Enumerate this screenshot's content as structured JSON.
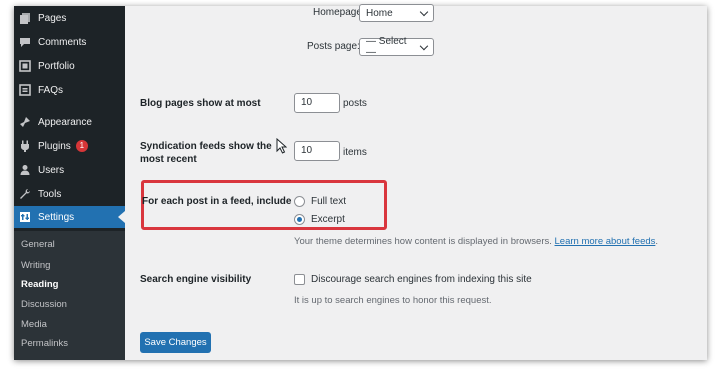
{
  "sidebar": {
    "items": [
      {
        "label": "Pages",
        "icon": "pages-icon"
      },
      {
        "label": "Comments",
        "icon": "comment-icon"
      },
      {
        "label": "Portfolio",
        "icon": "portfolio-icon"
      },
      {
        "label": "FAQs",
        "icon": "faq-icon"
      },
      {
        "label": "Appearance",
        "icon": "appearance-icon"
      },
      {
        "label": "Plugins",
        "icon": "plugins-icon",
        "badge": "1"
      },
      {
        "label": "Users",
        "icon": "users-icon"
      },
      {
        "label": "Tools",
        "icon": "tools-icon"
      },
      {
        "label": "Settings",
        "icon": "settings-icon",
        "active": true
      }
    ],
    "submenu": [
      {
        "label": "General"
      },
      {
        "label": "Writing"
      },
      {
        "label": "Reading",
        "current": true
      },
      {
        "label": "Discussion"
      },
      {
        "label": "Media"
      },
      {
        "label": "Permalinks"
      }
    ]
  },
  "settings": {
    "homepage_label": "Homepage:",
    "homepage_value": "Home",
    "posts_page_label": "Posts page:",
    "posts_page_value": "— Select —",
    "blog_pages_label": "Blog pages show at most",
    "blog_pages_value": "10",
    "blog_pages_unit": "posts",
    "syndication_label_line1": "Syndication feeds show the",
    "syndication_label_line2": "most recent",
    "syndication_value": "10",
    "syndication_unit": "items",
    "feed_include_label": "For each post in a feed, include",
    "feed_options": [
      {
        "label": "Full text",
        "checked": false
      },
      {
        "label": "Excerpt",
        "checked": true
      }
    ],
    "feed_desc": "Your theme determines how content is displayed in browsers.",
    "feed_desc_link": "Learn more about feeds",
    "feed_desc_end": ".",
    "search_visibility_label": "Search engine visibility",
    "search_visibility_checkbox": "Discourage search engines from indexing this site",
    "search_visibility_checked": false,
    "search_visibility_desc": "It is up to search engines to honor this request.",
    "save_button": "Save Changes"
  },
  "colors": {
    "sidebar_bg": "#1d2327",
    "accent": "#2271b1",
    "badge": "#d63638",
    "highlight": "#d9363e"
  }
}
